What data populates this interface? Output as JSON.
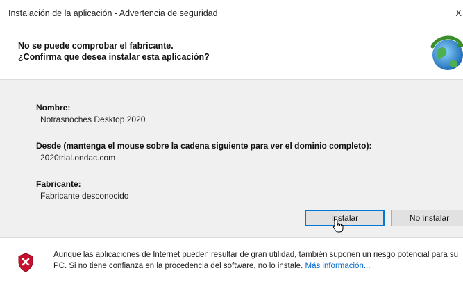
{
  "window": {
    "title": "Instalación de la aplicación - Advertencia de seguridad",
    "close_glyph": "X"
  },
  "header": {
    "line1": "No se puede comprobar el fabricante.",
    "line2": "¿Confirma que desea instalar esta aplicación?",
    "icon": "clickonce-globe-icon"
  },
  "details": {
    "name_label": "Nombre:",
    "name_value": "Notrasnoches Desktop 2020",
    "from_label": "Desde (mantenga el mouse sobre la cadena siguiente para ver el dominio completo):",
    "from_value": "2020trial.ondac.com",
    "publisher_label": "Fabricante:",
    "publisher_value": "Fabricante desconocido"
  },
  "buttons": {
    "install": "Instalar",
    "no_install": "No instalar"
  },
  "footer": {
    "warning_text": "Aunque las aplicaciones de Internet pueden resultar de gran utilidad, también suponen un riesgo potencial para su PC. Si no tiene confianza en la procedencia del software, no lo instale.",
    "more_info_link": "Más información...",
    "icon": "security-shield-icon"
  },
  "colors": {
    "main_bg": "#f0f0f0",
    "link": "#0066cc",
    "focus_border": "#0078d7",
    "shield_red": "#c8102e"
  }
}
